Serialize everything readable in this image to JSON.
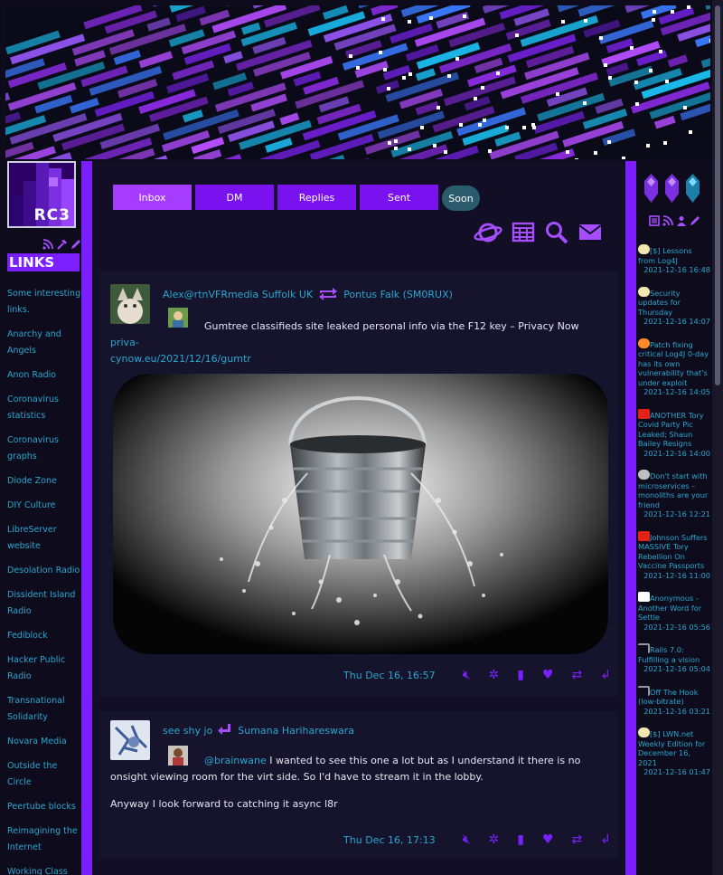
{
  "colors": {
    "accent": "#7b1fff",
    "link": "#29a7ce",
    "background": "#0d0b1c",
    "panel": "#110e25"
  },
  "logo": {
    "text": "RC3"
  },
  "left_icons": [
    "rss-icon",
    "hammer-icon",
    "edit-icon"
  ],
  "links": {
    "heading": "LINKS",
    "items": [
      "Some interesting links.",
      "Anarchy and Angels",
      "Anon Radio",
      "Coronavirus statistics",
      "Coronavirus graphs",
      "Diode Zone",
      "DIY Culture",
      "LibreServer website",
      "Desolation Radio",
      "Dissident Island Radio",
      "Fediblock",
      "Hacker Public Radio",
      "Transnational Solidarity",
      "Novara Media",
      "Outside the Circle",
      "Peertube blocks",
      "Reimagining the Internet",
      "Working Class"
    ]
  },
  "tabs": [
    {
      "label": "Inbox",
      "active": true
    },
    {
      "label": "DM",
      "active": false
    },
    {
      "label": "Replies",
      "active": false
    },
    {
      "label": "Sent",
      "active": false
    }
  ],
  "soon_label": "Soon",
  "top_icons": [
    "planet-icon",
    "calendar-icon",
    "search-icon",
    "mail-icon"
  ],
  "posts": [
    {
      "author": "Alex@rtnVFRmedia Suffolk UK",
      "relation": "repeat",
      "target": "Pontus Falk (SM0RUX)",
      "text": "Gumtree classifieds site leaked personal info via the F12 key – Privacy Now ",
      "link": "privacynow.eu/2021/12/16/gumtr",
      "link_start": "priva-",
      "link_rest": "cynow.eu/2021/12/16/gumtr",
      "image": "leaking-bucket",
      "date": "Thu Dec 16, 16:57"
    },
    {
      "author": "see shy jo",
      "relation": "reply",
      "target": "Sumana Harihareswara",
      "mention": "@brainwane",
      "text": " I wanted to see this one a lot but as I understand it there is no onsight viewing room for the virt side. So I'd have to stream it in the lobby.",
      "text2": "Anyway I look forward to catching it async l8r",
      "date": "Thu Dec 16, 17:13"
    }
  ],
  "actions": [
    "mute-icon",
    "bug-icon",
    "bookmark-icon",
    "like-icon",
    "repeat-icon",
    "reply-icon"
  ],
  "right_icons": [
    "newspaper-icon",
    "rss-icon",
    "person-icon",
    "edit-icon"
  ],
  "feed": [
    {
      "icon": "duck",
      "title": "[$] Lessons from Log4J",
      "date": "2021-12-16 16:48"
    },
    {
      "icon": "duck",
      "title": "Security updates for Thursday",
      "date": "2021-12-16 14:07"
    },
    {
      "icon": "orange",
      "title": "Patch fixing critical Log4J 0-day has its own vulnerability that's under exploit",
      "date": "2021-12-16 14:05"
    },
    {
      "icon": "youtube",
      "title": "ANOTHER Tory Covid Party Pic Leaked; Shaun Bailey Resigns",
      "date": "2021-12-16 14:00"
    },
    {
      "icon": "ad",
      "title": "Don't start with microservices – monoliths are your friend",
      "date": "2021-12-16 12:21"
    },
    {
      "icon": "youtube",
      "title": "Johnson Suffers MASSIVE Tory Rebellion On Vaccine Passports",
      "date": "2021-12-16 11:00"
    },
    {
      "icon": "bird",
      "title": "Anonymous - Another Word for Settle",
      "date": "2021-12-16 05:56"
    },
    {
      "icon": "arrow",
      "title": "Rails 7.0: Fulfilling a vision",
      "date": "2021-12-16 05:04"
    },
    {
      "icon": "arrow",
      "title": "Off The Hook (low-bitrate)",
      "date": "2021-12-16 03:21"
    },
    {
      "icon": "duck",
      "title": "[$] LWN.net Weekly Edition for December 16, 2021",
      "date": "2021-12-16 01:47"
    }
  ]
}
